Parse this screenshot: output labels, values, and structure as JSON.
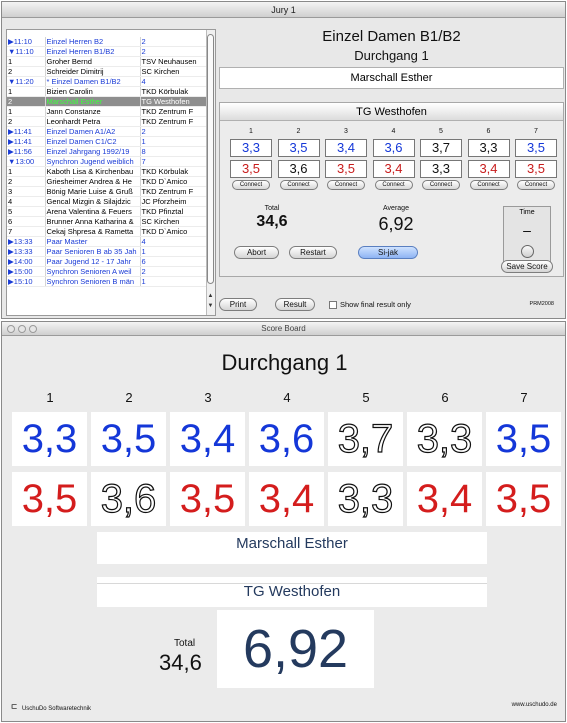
{
  "jury": {
    "window_title": "Jury 1",
    "runs": [
      {
        "time": "▶11:10",
        "name": "Einzel Herren B2",
        "info": "2",
        "group": true
      },
      {
        "time": "▼11:10",
        "name": "Einzel Herren B1/B2",
        "info": "2",
        "group": true
      },
      {
        "time": "1",
        "name": "Groher Bernd",
        "info": "TSV Neuhausen",
        "group": false
      },
      {
        "time": "2",
        "name": "Schreider Dimitrij",
        "info": "SC Kirchen",
        "group": false
      },
      {
        "time": "▼11:20",
        "name": "* Einzel Damen B1/B2",
        "info": "4",
        "group": true
      },
      {
        "time": "1",
        "name": "Bizien Carolin",
        "info": "TKD Körbulak",
        "group": false
      },
      {
        "time": "2",
        "name": "Marschall Esther",
        "info": "TG Westhofen",
        "group": false,
        "selected": true
      },
      {
        "time": "1",
        "name": "Jann Constanze",
        "info": "TKD Zentrum F",
        "group": false
      },
      {
        "time": "2",
        "name": "Leonhardt Petra",
        "info": "TKD Zentrum F",
        "group": false
      },
      {
        "time": "▶11:41",
        "name": "Einzel Damen A1/A2",
        "info": "2",
        "group": true
      },
      {
        "time": "▶11:41",
        "name": "Einzel Damen C1/C2",
        "info": "1",
        "group": true
      },
      {
        "time": "▶11:56",
        "name": "Einzel Jahrgang 1992/19",
        "info": "8",
        "group": true
      },
      {
        "time": "▼13:00",
        "name": "Synchron Jugend weiblich",
        "info": "7",
        "group": true
      },
      {
        "time": "1",
        "name": "Kaboth Lisa & Kirchenbau",
        "info": "TKD Körbulak",
        "group": false
      },
      {
        "time": "2",
        "name": "Griesheimer Andrea & He",
        "info": "TKD D`Amico",
        "group": false
      },
      {
        "time": "3",
        "name": "Bönig Marie Luise & Gruß",
        "info": "TKD Zentrum F",
        "group": false
      },
      {
        "time": "4",
        "name": "Gencal Mizgin & Silajdzic",
        "info": "JC Pforzheim",
        "group": false
      },
      {
        "time": "5",
        "name": "Arena Valentina & Feuers",
        "info": "TKD Pfinztal",
        "group": false
      },
      {
        "time": "6",
        "name": "Brunner Anna Katharina &",
        "info": "SC Kirchen",
        "group": false
      },
      {
        "time": "7",
        "name": "Cekaj Shpresa & Rametta",
        "info": "TKD D`Amico",
        "group": false
      },
      {
        "time": "▶13:33",
        "name": "Paar Master",
        "info": "4",
        "group": true
      },
      {
        "time": "▶13:33",
        "name": "Paar Senioren B ab 35 Jah",
        "info": "1",
        "group": true
      },
      {
        "time": "▶14:00",
        "name": "Paar Jugend 12 - 17 Jahr",
        "info": "6",
        "group": true
      },
      {
        "time": "▶15:00",
        "name": "Synchron Senioren A weil",
        "info": "2",
        "group": true
      },
      {
        "time": "▶15:10",
        "name": "Synchron Senioren B män",
        "info": "1",
        "group": true
      }
    ],
    "event_title": "Einzel Damen B1/B2",
    "run_title": "Durchgang 1",
    "athlete": "Marschall Esther",
    "club": "TG Westhofen",
    "judges": [
      {
        "num": "1",
        "score1": "3,3",
        "color1": "blue",
        "score2": "3,5",
        "color2": "red"
      },
      {
        "num": "2",
        "score1": "3,5",
        "color1": "blue",
        "score2": "3,6",
        "color2": "black"
      },
      {
        "num": "3",
        "score1": "3,4",
        "color1": "blue",
        "score2": "3,5",
        "color2": "red"
      },
      {
        "num": "4",
        "score1": "3,6",
        "color1": "blue",
        "score2": "3,4",
        "color2": "red"
      },
      {
        "num": "5",
        "score1": "3,7",
        "color1": "black",
        "score2": "3,3",
        "color2": "black"
      },
      {
        "num": "6",
        "score1": "3,3",
        "color1": "black",
        "score2": "3,4",
        "color2": "red"
      },
      {
        "num": "7",
        "score1": "3,5",
        "color1": "blue",
        "score2": "3,5",
        "color2": "red"
      }
    ],
    "connect_label": "Connect",
    "total_label": "Total",
    "total_value": "34,6",
    "average_label": "Average",
    "average_value": "6,92",
    "time_label": "Time",
    "time_value": "–",
    "abort_label": "Abort",
    "restart_label": "Restart",
    "sijak_label": "Si-jak",
    "save_label": "Save Score",
    "print_label": "Print",
    "result_label": "Result",
    "show_final_label": "Show final result only",
    "prm_label": "PRM2008"
  },
  "board": {
    "window_title": "Score Board",
    "run_title": "Durchgang 1",
    "judges": [
      {
        "num": "1",
        "score1": "3,3",
        "style1": "blue",
        "score2": "3,5",
        "style2": "red"
      },
      {
        "num": "2",
        "score1": "3,5",
        "style1": "blue",
        "score2": "3,6",
        "style2": "outline"
      },
      {
        "num": "3",
        "score1": "3,4",
        "style1": "blue",
        "score2": "3,5",
        "style2": "red"
      },
      {
        "num": "4",
        "score1": "3,6",
        "style1": "blue",
        "score2": "3,4",
        "style2": "red"
      },
      {
        "num": "5",
        "score1": "3,7",
        "style1": "outline",
        "score2": "3,3",
        "style2": "outline"
      },
      {
        "num": "6",
        "score1": "3,3",
        "style1": "outline",
        "score2": "3,4",
        "style2": "red"
      },
      {
        "num": "7",
        "score1": "3,5",
        "style1": "blue",
        "score2": "3,5",
        "style2": "red"
      }
    ],
    "athlete": "Marschall Esther",
    "club": "TG Westhofen",
    "total_label": "Total",
    "total_value": "34,6",
    "average_value": "6,92",
    "logo_mark": "ㄷ",
    "logo_text": "UschuDo Softwaretechnik",
    "url": "www.uschudo.de"
  }
}
